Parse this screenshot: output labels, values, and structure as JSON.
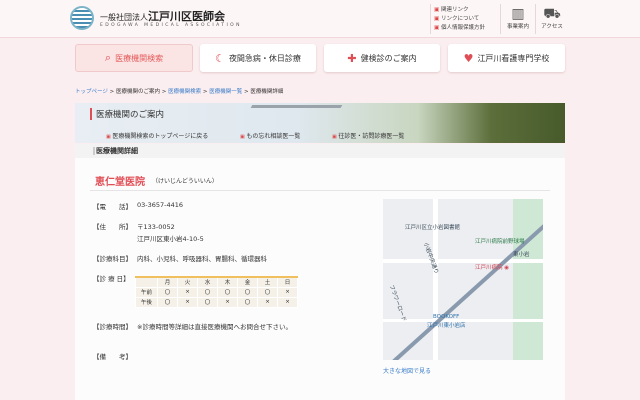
{
  "header": {
    "org_prefix": "一般社団法人",
    "org_name": "江戸川区医師会",
    "org_en": "EDOGAWA MEDICAL ASSOCIATION",
    "links": [
      "関連リンク",
      "リンクについて",
      "個人情報保護方針"
    ],
    "icons": [
      {
        "label": "事業案内",
        "icon": "building-icon"
      },
      {
        "label": "アクセス",
        "icon": "car-icon"
      }
    ]
  },
  "nav": [
    {
      "label": "医療機関検索",
      "icon": "search-icon"
    },
    {
      "label": "夜間急病・休日診療",
      "icon": "moon-star-icon"
    },
    {
      "label": "健検診のご案内",
      "icon": "medical-bag-icon"
    },
    {
      "label": "江戸川看護専門学校",
      "icon": "heart-icon"
    }
  ],
  "breadcrumb": [
    "トップページ",
    "医療機関のご案内",
    "医療機関検索",
    "医療機関一覧",
    "医療機関詳細"
  ],
  "banner": {
    "title": "医療機関のご案内",
    "links": [
      "医療機関検索のトップページに戻る",
      "もの忘れ相談医一覧",
      "往診医・訪問診療医一覧"
    ]
  },
  "section_title": "医療機関詳細",
  "clinic": {
    "name": "恵仁堂医院",
    "kana": "（けいじんどういいん）",
    "phone_label": "【電　　話】",
    "phone": "03-3657-4416",
    "address_label": "【住　　所】",
    "postal": "〒133-0052",
    "address": "江戸川区東小岩4-10-5",
    "dept_label": "【診療科目】",
    "depts": "内科、小児科、呼吸器科、胃腸科、循環器科",
    "days_label": "【診 療 日】",
    "hours_label": "【診療時間】",
    "hours": "※診療時間等詳細は直接医療機関へお問合せ下さい。",
    "notes_label": "【備　　考】"
  },
  "schedule": {
    "days": [
      "月",
      "火",
      "水",
      "木",
      "金",
      "土",
      "日"
    ],
    "rows": [
      {
        "label": "午前",
        "marks": [
          "〇",
          "×",
          "〇",
          "〇",
          "〇",
          "〇",
          "×"
        ]
      },
      {
        "label": "午後",
        "marks": [
          "〇",
          "×",
          "〇",
          "×",
          "〇",
          "×",
          "×"
        ]
      }
    ]
  },
  "map": {
    "labels": [
      "江戸川区立小岩図書館",
      "江戸川病院前野球場",
      "東小岩",
      "江戸川病院",
      "小岩中央通り",
      "フラワーロード",
      "BOOKOFF",
      "江戸川東小岩店"
    ],
    "link": "大きな地図で見る"
  }
}
